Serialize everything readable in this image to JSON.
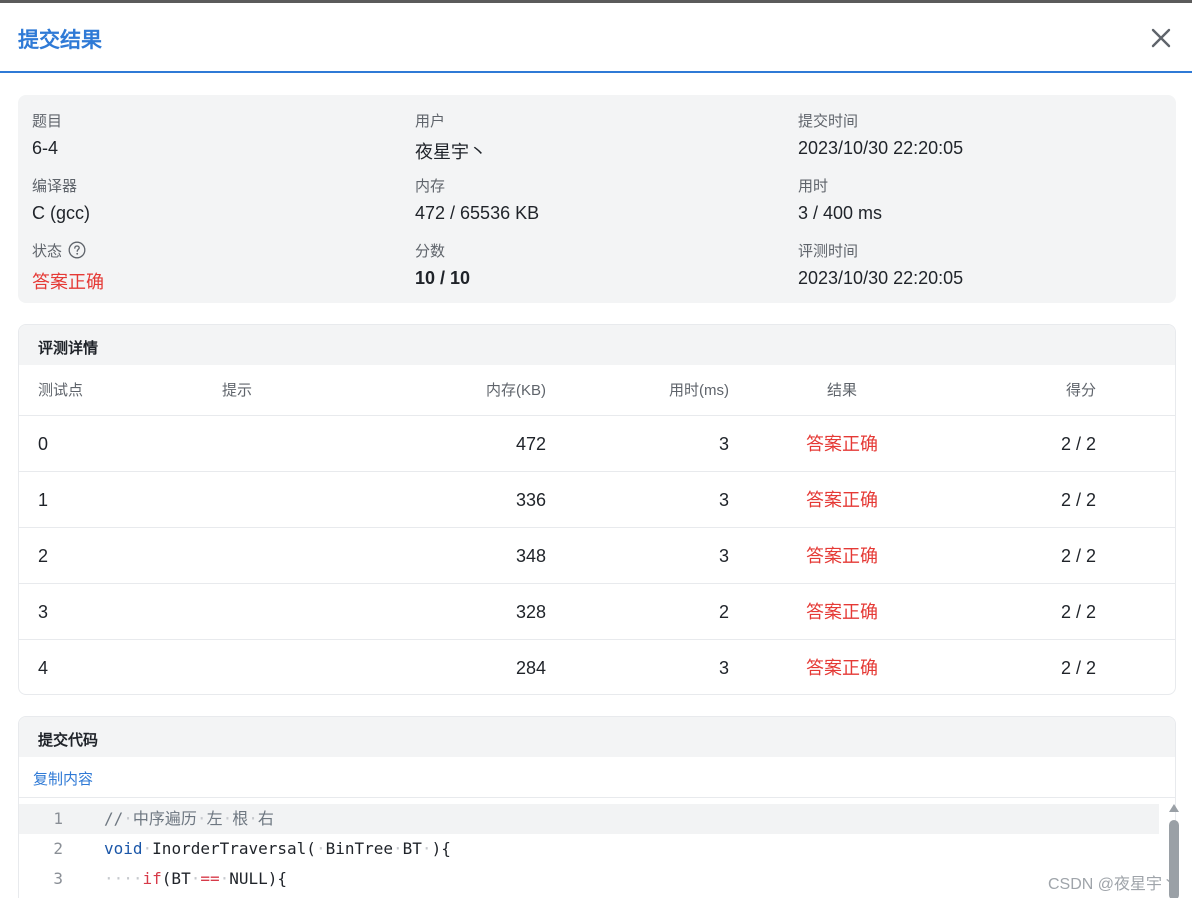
{
  "modal": {
    "title": "提交结果"
  },
  "info": {
    "problem_label": "题目",
    "problem_value": "6-4",
    "user_label": "用户",
    "user_value": "夜星宇丶",
    "submit_time_label": "提交时间",
    "submit_time_value": "2023/10/30 22:20:05",
    "compiler_label": "编译器",
    "compiler_value": "C (gcc)",
    "memory_label": "内存",
    "memory_value": "472 / 65536 KB",
    "time_label": "用时",
    "time_value": "3 / 400 ms",
    "status_label": "状态",
    "status_value": "答案正确",
    "score_label": "分数",
    "score_value": "10 / 10",
    "judge_time_label": "评测时间",
    "judge_time_value": "2023/10/30 22:20:05"
  },
  "details": {
    "title": "评测详情",
    "columns": {
      "id": "测试点",
      "hint": "提示",
      "memory": "内存(KB)",
      "time": "用时(ms)",
      "result": "结果",
      "score": "得分"
    },
    "rows": [
      {
        "id": "0",
        "hint": "",
        "memory": "472",
        "time": "3",
        "result": "答案正确",
        "score": "2 / 2"
      },
      {
        "id": "1",
        "hint": "",
        "memory": "336",
        "time": "3",
        "result": "答案正确",
        "score": "2 / 2"
      },
      {
        "id": "2",
        "hint": "",
        "memory": "348",
        "time": "3",
        "result": "答案正确",
        "score": "2 / 2"
      },
      {
        "id": "3",
        "hint": "",
        "memory": "328",
        "time": "2",
        "result": "答案正确",
        "score": "2 / 2"
      },
      {
        "id": "4",
        "hint": "",
        "memory": "284",
        "time": "3",
        "result": "答案正确",
        "score": "2 / 2"
      }
    ]
  },
  "code": {
    "title": "提交代码",
    "copy_label": "复制内容",
    "lines": [
      {
        "num": "1",
        "tokens": [
          {
            "t": "//",
            "c": "comment"
          },
          {
            "t": "·",
            "c": "ws"
          },
          {
            "t": "中序遍历",
            "c": "comment"
          },
          {
            "t": "·",
            "c": "ws"
          },
          {
            "t": "左",
            "c": "comment"
          },
          {
            "t": "·",
            "c": "ws"
          },
          {
            "t": "根",
            "c": "comment"
          },
          {
            "t": "·",
            "c": "ws"
          },
          {
            "t": "右",
            "c": "comment"
          }
        ]
      },
      {
        "num": "2",
        "tokens": [
          {
            "t": "void",
            "c": "keyword"
          },
          {
            "t": "·",
            "c": "ws"
          },
          {
            "t": "InorderTraversal(",
            "c": "func"
          },
          {
            "t": "·",
            "c": "ws"
          },
          {
            "t": "BinTree",
            "c": "func"
          },
          {
            "t": "·",
            "c": "ws"
          },
          {
            "t": "BT",
            "c": "func"
          },
          {
            "t": "·",
            "c": "ws"
          },
          {
            "t": "){",
            "c": "func"
          }
        ]
      },
      {
        "num": "3",
        "tokens": [
          {
            "t": "····",
            "c": "ws"
          },
          {
            "t": "if",
            "c": "ctrl"
          },
          {
            "t": "(BT",
            "c": "func"
          },
          {
            "t": "·",
            "c": "ws"
          },
          {
            "t": "==",
            "c": "ctrl"
          },
          {
            "t": "·",
            "c": "ws"
          },
          {
            "t": "NULL){",
            "c": "func"
          }
        ]
      }
    ]
  },
  "watermark": "CSDN @夜星宇丶"
}
